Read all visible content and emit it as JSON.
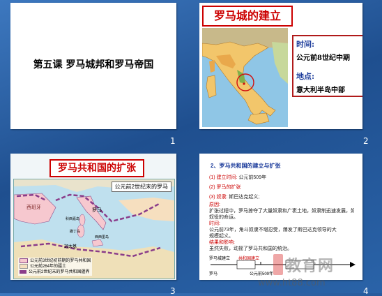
{
  "slides": [
    {
      "title": "第五课 罗马城邦和罗马帝国",
      "number": "1"
    },
    {
      "title": "罗马城的建立",
      "time_label": "时间:",
      "time_value": "公元前8世纪中期",
      "place_label": "地点:",
      "place_value": "意大利半岛中部",
      "number": "2"
    },
    {
      "title": "罗马共和国的扩张",
      "map_title": "公元前2世纪末的罗马",
      "labels": [
        "西班牙",
        "罗马",
        "科西嘉岛",
        "撒丁岛",
        "迦太基",
        "西西里岛"
      ],
      "legend": [
        "公元前3世纪初前期的罗马共和国",
        "公元前264年的疆土",
        "公元前2世纪末的罗马共和国疆界"
      ],
      "number": "3"
    },
    {
      "heading": "2、罗马共和国的建立与扩张",
      "item1_label": "(1) 建立时间:",
      "item1_value": "公元前509年",
      "item2": "(2) 罗马的扩张",
      "item3_label": "(3) 奴隶:",
      "item3_value": "斯巴达克起义;",
      "cause_label": "原因:",
      "cause_text": "扩张过程中，罗马掠夺了大量奴隶和广袤土地，奴隶制迅速发展，奴隶遭奴隶主残酷",
      "cause_text2": "奴役的命运。",
      "time_label": "时间:",
      "time_text": "公元前73年，角斗奴隶不堪忍受，爆发了斯巴达克领导的大",
      "time_text2": "规模起义。",
      "result_label": "结果和影响:",
      "result_text": "虽然失败，动摇了罗马共和国的统治。",
      "timeline": [
        "罗马城建立",
        "共和国建立",
        "罗马",
        "公元前509年"
      ],
      "number": "4"
    }
  ],
  "watermark": {
    "text": "教育网",
    "url": "www.ht88.com"
  },
  "colors": {
    "background": "#2f63a6",
    "accent": "#cc0000",
    "blue": "#1a3a9a"
  }
}
